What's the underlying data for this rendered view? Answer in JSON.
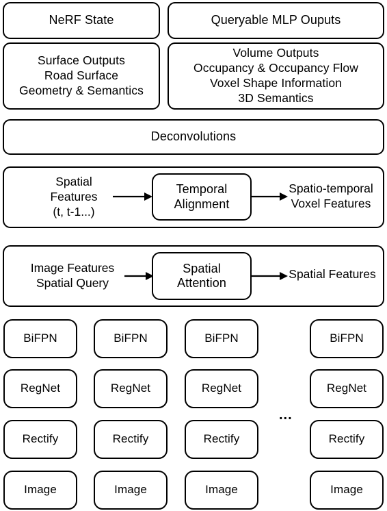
{
  "diagram": {
    "title": "NeRF state and multi-camera feature pipeline block diagram",
    "stroke_color": "#000000",
    "fill_color": "#ffffff",
    "ellipsis": "...",
    "blocks": {
      "nerf_state": "NeRF State",
      "queryable_mlp_outputs": "Queryable MLP Ouputs",
      "surface_outputs": "Surface Outputs\nRoad Surface\nGeometry & Semantics",
      "volume_outputs": "Volume Outputs\nOccupancy & Occupancy Flow\nVoxel Shape Information\n3D Semantics",
      "deconvolutions": "Deconvolutions",
      "temporal_input": "Spatial\nFeatures\n(t, t-1...)",
      "temporal_alignment": "Temporal\nAlignment",
      "temporal_output": "Spatio-temporal\nVoxel Features",
      "attention_input": "Image Features\nSpatial Query",
      "spatial_attention": "Spatial\nAttention",
      "attention_output": "Spatial Features"
    },
    "columns": [
      {
        "bifpn": "BiFPN",
        "regnet": "RegNet",
        "rectify": "Rectify",
        "image": "Image"
      },
      {
        "bifpn": "BiFPN",
        "regnet": "RegNet",
        "rectify": "Rectify",
        "image": "Image"
      },
      {
        "bifpn": "BiFPN",
        "regnet": "RegNet",
        "rectify": "Rectify",
        "image": "Image"
      },
      {
        "bifpn": "BiFPN",
        "regnet": "RegNet",
        "rectify": "Rectify",
        "image": "Image"
      }
    ]
  }
}
